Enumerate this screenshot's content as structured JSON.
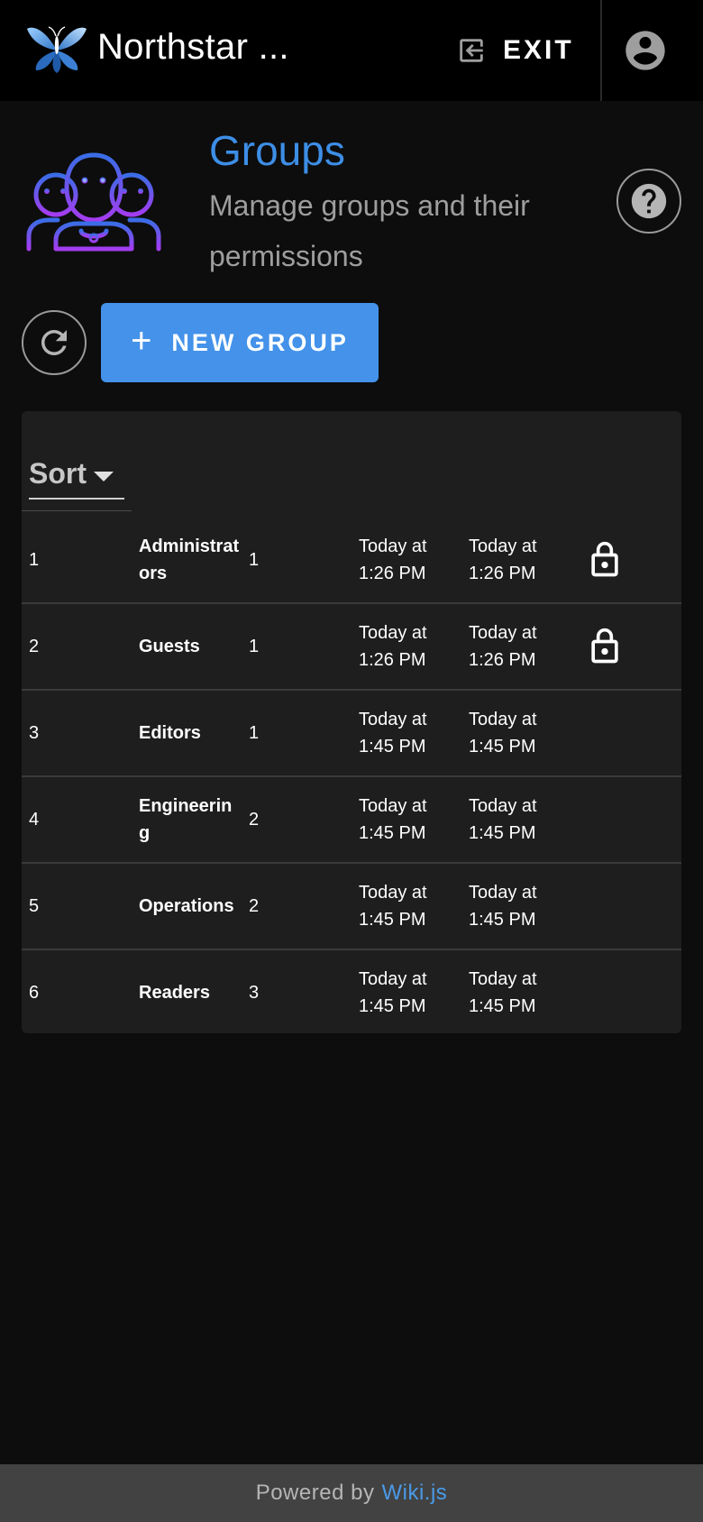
{
  "appbar": {
    "title": "Northstar ...",
    "exit_label": "EXIT",
    "icons": {
      "logo": "wikijs-butterfly-logo",
      "exit": "login-variant-icon",
      "account": "account-circle-icon"
    }
  },
  "header": {
    "title": "Groups",
    "subtitle": "Manage groups and their permissions",
    "illustration": "three-users-icon",
    "help_icon": "help-circle-icon"
  },
  "actions": {
    "refresh_icon": "refresh-icon",
    "new_group_label": "NEW GROUP",
    "new_group_icon": "plus-icon"
  },
  "table": {
    "sort_label": "Sort",
    "rows": [
      {
        "id": "1",
        "name": "Administrators",
        "users": "1",
        "created": "Today at 1:26 PM",
        "updated": "Today at 1:26 PM",
        "locked": true
      },
      {
        "id": "2",
        "name": "Guests",
        "users": "1",
        "created": "Today at 1:26 PM",
        "updated": "Today at 1:26 PM",
        "locked": true
      },
      {
        "id": "3",
        "name": "Editors",
        "users": "1",
        "created": "Today at 1:45 PM",
        "updated": "Today at 1:45 PM",
        "locked": false
      },
      {
        "id": "4",
        "name": "Engineering",
        "users": "2",
        "created": "Today at 1:45 PM",
        "updated": "Today at 1:45 PM",
        "locked": false
      },
      {
        "id": "5",
        "name": "Operations",
        "users": "2",
        "created": "Today at 1:45 PM",
        "updated": "Today at 1:45 PM",
        "locked": false
      },
      {
        "id": "6",
        "name": "Readers",
        "users": "3",
        "created": "Today at 1:45 PM",
        "updated": "Today at 1:45 PM",
        "locked": false
      }
    ]
  },
  "footer": {
    "prefix": "Powered by",
    "link": "Wiki.js"
  },
  "colors": {
    "accent": "#4492ea",
    "title_blue": "#3d8ee6",
    "illustration_gradient_start": "#3a6de6",
    "illustration_gradient_end": "#a43cf0",
    "background": "#0d0d0d",
    "card": "#1e1e1e"
  }
}
